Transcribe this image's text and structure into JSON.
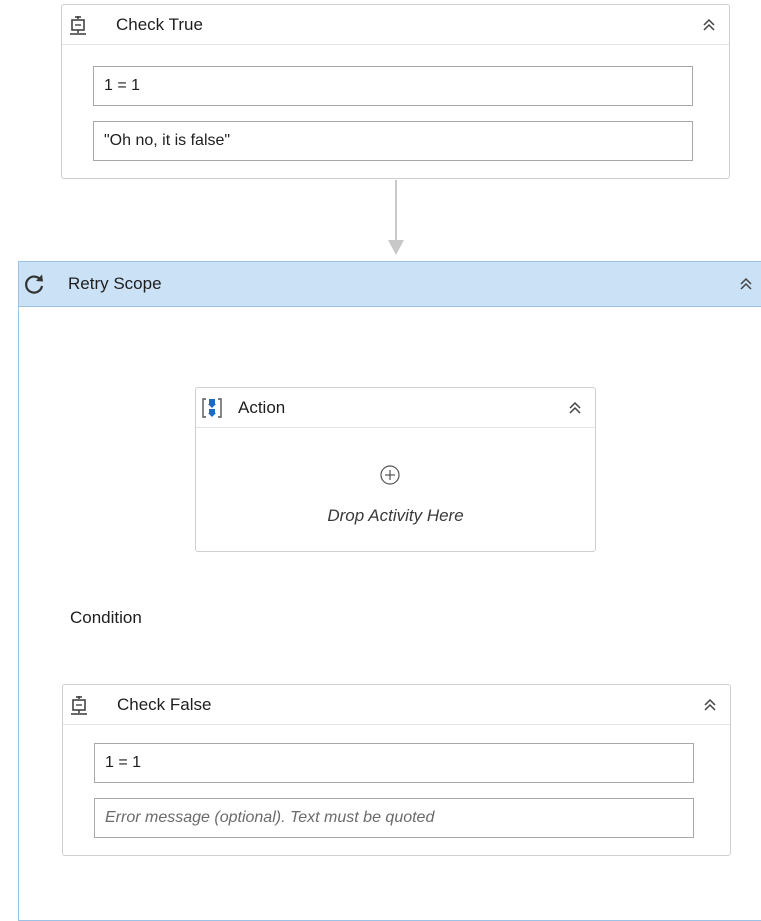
{
  "check_true": {
    "title": "Check True",
    "condition_value": "1 = 1",
    "message_value": "\"Oh no, it is false\""
  },
  "retry_scope": {
    "title": "Retry Scope",
    "action": {
      "title": "Action",
      "drop_text": "Drop Activity Here"
    },
    "condition_label": "Condition",
    "check_false": {
      "title": "Check False",
      "condition_value": "1 = 1",
      "message_placeholder": "Error message (optional). Text must be quoted"
    }
  },
  "icons": {
    "check": "check-activity-icon",
    "retry": "retry-icon",
    "sequence": "sequence-icon",
    "collapse": "collapse-chevron-icon",
    "add": "add-circle-icon"
  },
  "colors": {
    "retry_header_bg": "#cbe1f5",
    "retry_border": "#9cc3e6",
    "sequence_blue": "#1c6bc4"
  }
}
